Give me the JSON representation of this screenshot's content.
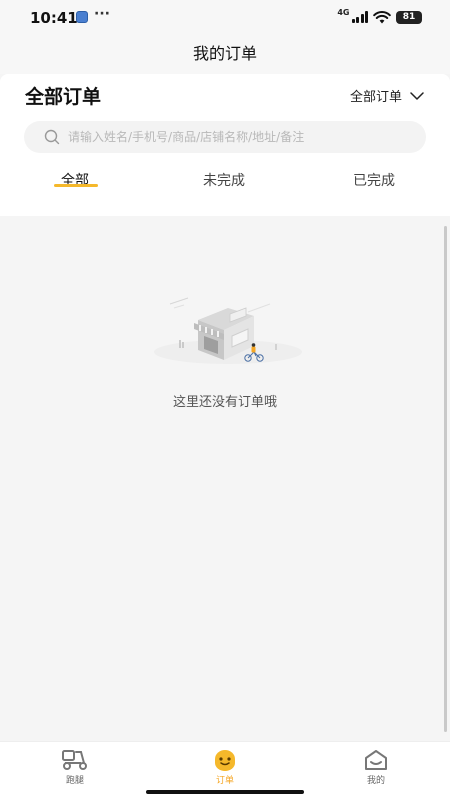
{
  "status_bar": {
    "time": "10:41",
    "more": "···",
    "network": "4G",
    "battery": "81"
  },
  "nav": {
    "title": "我的订单"
  },
  "header": {
    "section_title": "全部订单",
    "filter_label": "全部订单"
  },
  "search": {
    "placeholder": "请输入姓名/手机号/商品/店铺名称/地址/备注",
    "value": ""
  },
  "tabs": [
    {
      "label": "全部",
      "active": true
    },
    {
      "label": "未完成",
      "active": false
    },
    {
      "label": "已完成",
      "active": false
    }
  ],
  "empty_state": {
    "message": "这里还没有订单哦"
  },
  "tab_bar": {
    "items": [
      {
        "label": "跑腿",
        "icon": "delivery-scooter-icon",
        "active": false
      },
      {
        "label": "订单",
        "icon": "orders-face-icon",
        "active": true
      },
      {
        "label": "我的",
        "icon": "profile-house-icon",
        "active": false
      }
    ]
  },
  "colors": {
    "accent": "#f5b82b",
    "active_tab_label": "#f5a623",
    "page_background": "#f5f5f5",
    "card_background": "#ffffff"
  }
}
